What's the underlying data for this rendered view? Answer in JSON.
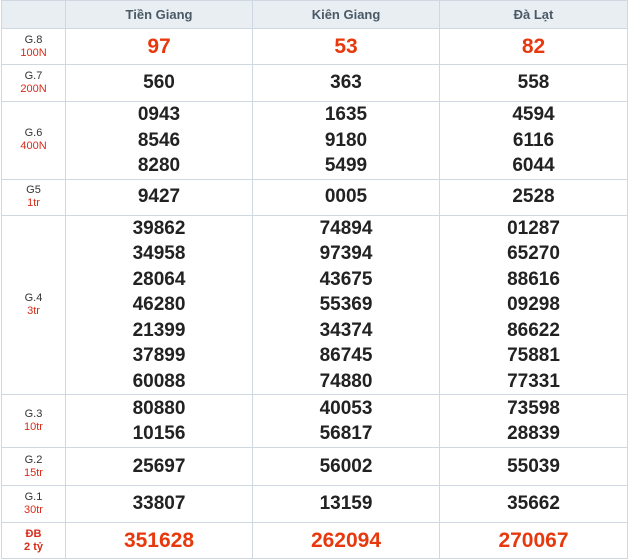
{
  "provinces": [
    "Tiền Giang",
    "Kiên Giang",
    "Đà Lạt"
  ],
  "prizes": [
    {
      "key": "g8",
      "name": "G.8",
      "amount": "100N",
      "special": false,
      "red": true,
      "values": [
        [
          "97"
        ],
        [
          "53"
        ],
        [
          "82"
        ]
      ]
    },
    {
      "key": "g7",
      "name": "G.7",
      "amount": "200N",
      "special": false,
      "red": false,
      "values": [
        [
          "560"
        ],
        [
          "363"
        ],
        [
          "558"
        ]
      ]
    },
    {
      "key": "g6",
      "name": "G.6",
      "amount": "400N",
      "special": false,
      "red": false,
      "values": [
        [
          "0943",
          "8546",
          "8280"
        ],
        [
          "1635",
          "9180",
          "5499"
        ],
        [
          "4594",
          "6116",
          "6044"
        ]
      ]
    },
    {
      "key": "g5",
      "name": "G5",
      "amount": "1tr",
      "special": false,
      "red": false,
      "values": [
        [
          "9427"
        ],
        [
          "0005"
        ],
        [
          "2528"
        ]
      ]
    },
    {
      "key": "g4",
      "name": "G.4",
      "amount": "3tr",
      "special": false,
      "red": false,
      "values": [
        [
          "39862",
          "34958",
          "28064",
          "46280",
          "21399",
          "37899",
          "60088"
        ],
        [
          "74894",
          "97394",
          "43675",
          "55369",
          "34374",
          "86745",
          "74880"
        ],
        [
          "01287",
          "65270",
          "88616",
          "09298",
          "86622",
          "75881",
          "77331"
        ]
      ]
    },
    {
      "key": "g3",
      "name": "G.3",
      "amount": "10tr",
      "special": false,
      "red": false,
      "values": [
        [
          "80880",
          "10156"
        ],
        [
          "40053",
          "56817"
        ],
        [
          "73598",
          "28839"
        ]
      ]
    },
    {
      "key": "g2",
      "name": "G.2",
      "amount": "15tr",
      "special": false,
      "red": false,
      "values": [
        [
          "25697"
        ],
        [
          "56002"
        ],
        [
          "55039"
        ]
      ]
    },
    {
      "key": "g1",
      "name": "G.1",
      "amount": "30tr",
      "special": false,
      "red": false,
      "values": [
        [
          "33807"
        ],
        [
          "13159"
        ],
        [
          "35662"
        ]
      ]
    },
    {
      "key": "db",
      "name": "ĐB",
      "amount": "2 tỷ",
      "special": true,
      "red": true,
      "values": [
        [
          "351628"
        ],
        [
          "262094"
        ],
        [
          "270067"
        ]
      ]
    }
  ]
}
